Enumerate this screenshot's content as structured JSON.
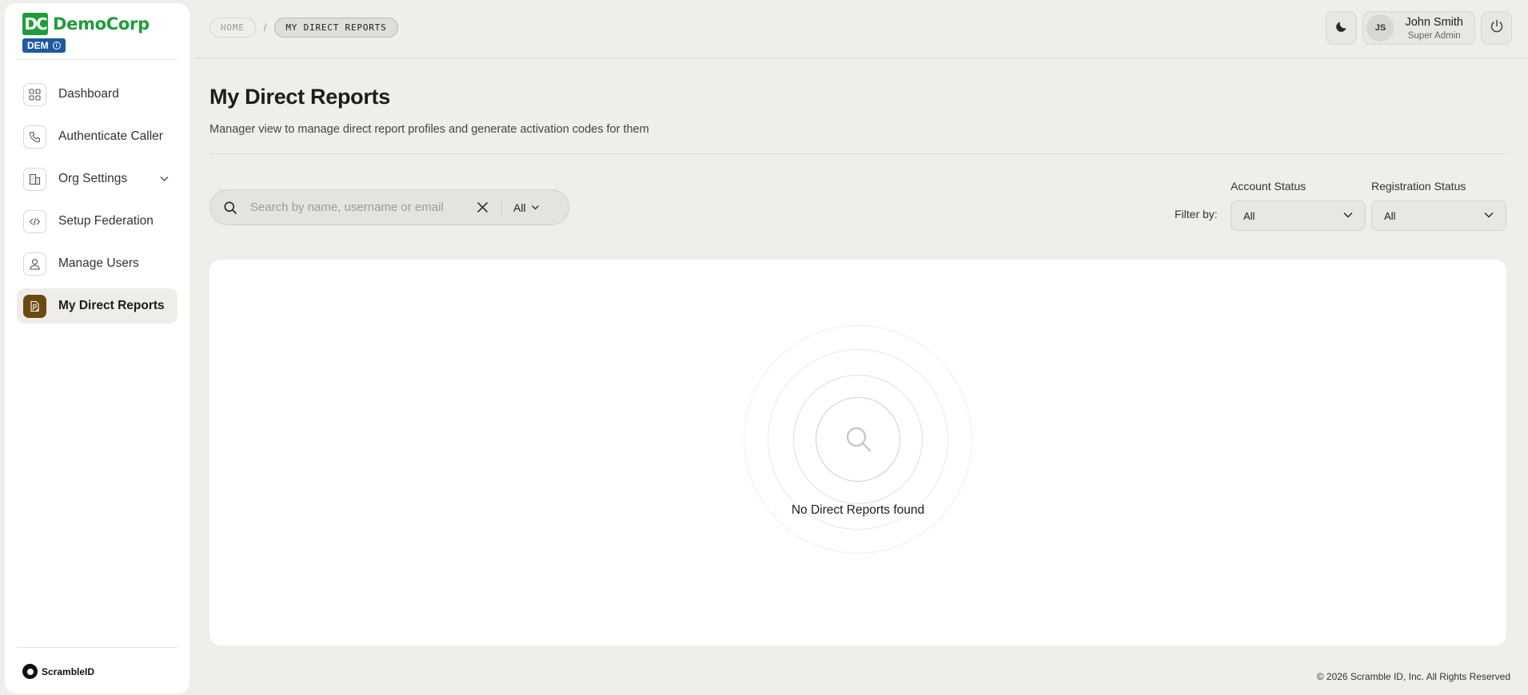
{
  "brand": {
    "logo_text": "DC",
    "name": "DemoCorp",
    "badge": "DEM",
    "badge_info": "i"
  },
  "sidebar": {
    "items": [
      {
        "label": "Dashboard",
        "icon": "grid-icon",
        "active": false
      },
      {
        "label": "Authenticate Caller",
        "icon": "phone-icon",
        "active": false
      },
      {
        "label": "Org Settings",
        "icon": "building-icon",
        "active": false,
        "expandable": true
      },
      {
        "label": "Setup Federation",
        "icon": "code-icon",
        "active": false
      },
      {
        "label": "Manage Users",
        "icon": "user-icon",
        "active": false
      },
      {
        "label": "My Direct Reports",
        "icon": "user-check-icon",
        "active": true
      }
    ],
    "footer_brand": "ScrambleID"
  },
  "breadcrumb": {
    "home": "HOME",
    "separator": "/",
    "current": "MY DIRECT REPORTS"
  },
  "header": {
    "theme_icon": "moon-icon",
    "user": {
      "initials": "JS",
      "name": "John Smith",
      "role": "Super Admin"
    },
    "logout_icon": "power-icon"
  },
  "page": {
    "title": "My Direct Reports",
    "subtitle": "Manager view to manage direct report profiles and generate activation codes for them"
  },
  "search": {
    "placeholder": "Search by name, username or email",
    "value": "",
    "scope": "All"
  },
  "filters": {
    "label": "Filter by:",
    "account_status": {
      "label": "Account Status",
      "value": "All"
    },
    "registration_status": {
      "label": "Registration Status",
      "value": "All"
    }
  },
  "empty_state": {
    "message": "No Direct Reports found"
  },
  "footer": {
    "copyright": "© 2026 Scramble ID, Inc. All Rights Reserved"
  },
  "colors": {
    "brand_green": "#1f9d3a",
    "badge_blue": "#1e5a9e",
    "active_icon_bg": "#6b4a12",
    "page_bg": "#efeeea"
  }
}
